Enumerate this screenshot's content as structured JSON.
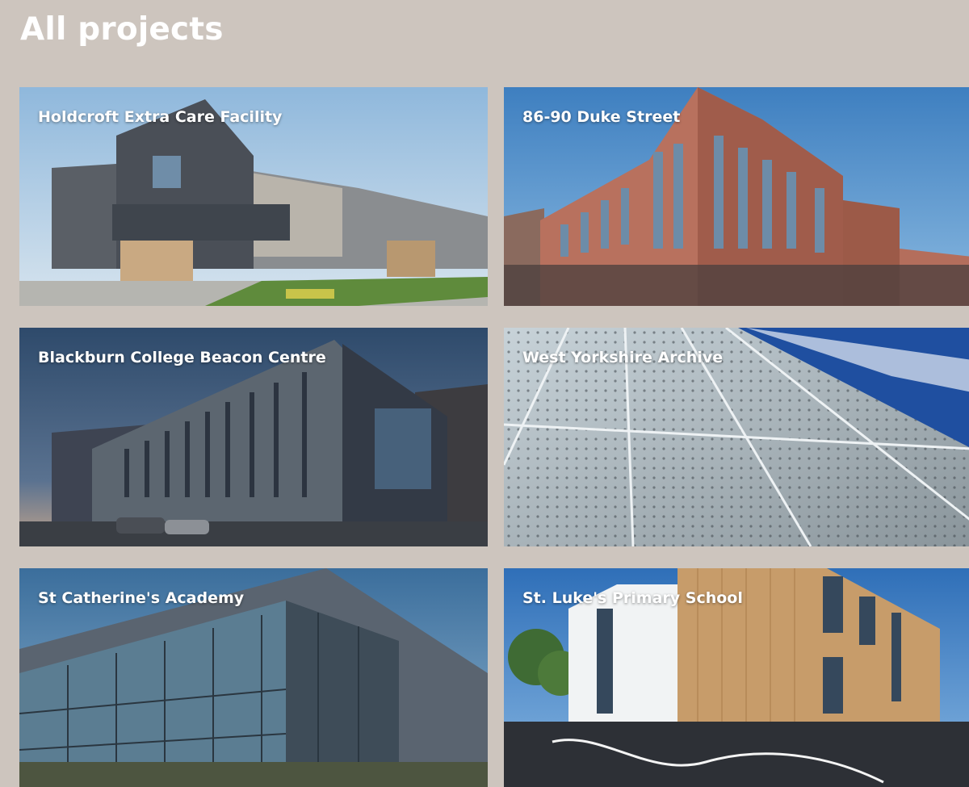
{
  "page": {
    "title": "All projects"
  },
  "projects": [
    {
      "title": "Holdcroft Extra Care Facility",
      "image": "modern housing building with dark cladding and timber frontage"
    },
    {
      "title": "86-90 Duke Street",
      "image": "red brick corner office building under blue sky"
    },
    {
      "title": "Blackburn College Beacon Centre",
      "image": "college building with vertical fins at dusk"
    },
    {
      "title": "West Yorkshire Archive",
      "image": "perforated metal facade against blue sky"
    },
    {
      "title": "St Catherine's Academy",
      "image": "glass curtain wall academy building"
    },
    {
      "title": "St. Luke's Primary School",
      "image": "timber clad primary school with playground"
    }
  ]
}
